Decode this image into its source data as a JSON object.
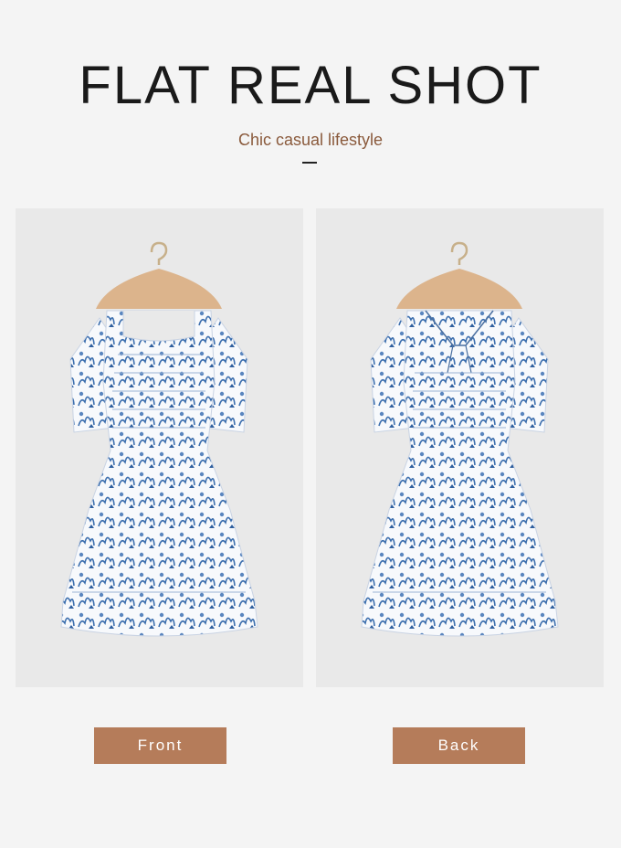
{
  "heading": {
    "title": "FLAT REAL SHOT",
    "subtitle": "Chic casual lifestyle"
  },
  "views": [
    {
      "label": "Front",
      "image": "dress-front-photo"
    },
    {
      "label": "Back",
      "image": "dress-back-photo"
    }
  ],
  "colors": {
    "background": "#f4f4f4",
    "accent": "#b57c5a",
    "subtitle": "#8a5a3c",
    "print": "#3d6fae"
  }
}
